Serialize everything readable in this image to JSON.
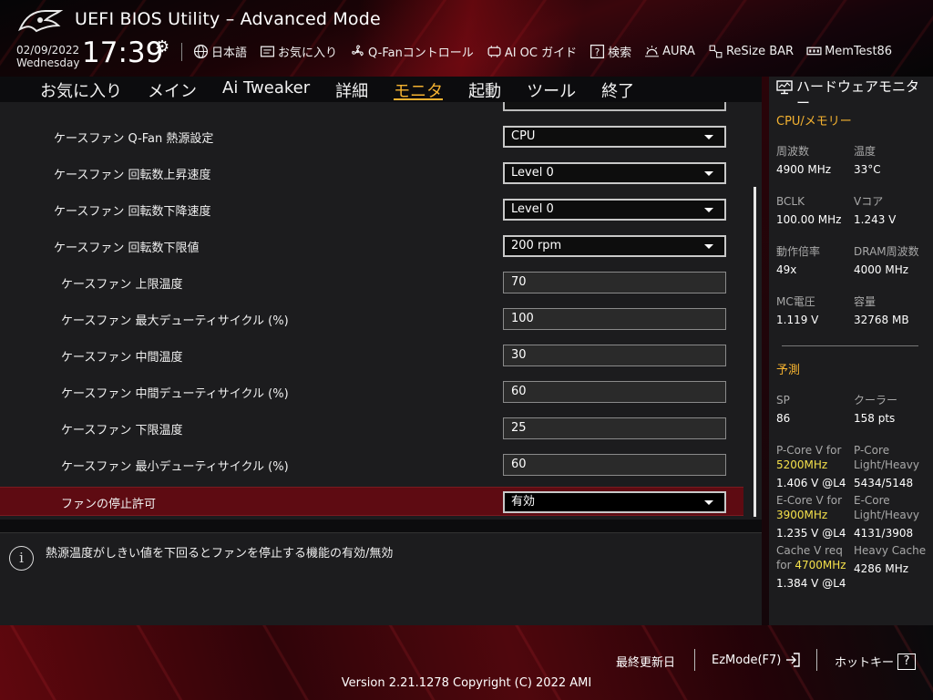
{
  "header": {
    "title": "UEFI BIOS Utility – Advanced Mode",
    "date": "02/09/2022",
    "weekday": "Wednesday",
    "time": "17:39"
  },
  "toolbar": [
    {
      "name": "language",
      "label": "日本語",
      "icon": "globe-icon"
    },
    {
      "name": "favorites",
      "label": "お気に入り",
      "icon": "favorites-icon"
    },
    {
      "name": "qfan",
      "label": "Q-Fanコントロール",
      "icon": "fan-icon"
    },
    {
      "name": "ai-oc",
      "label": "AI OC ガイド",
      "icon": "ai-chip-icon"
    },
    {
      "name": "search",
      "label": "検索",
      "icon": "help-search-icon"
    },
    {
      "name": "aura",
      "label": "AURA",
      "icon": "aura-light-icon"
    },
    {
      "name": "resize-bar",
      "label": "ReSize BAR",
      "icon": "resize-bar-icon"
    },
    {
      "name": "memtest",
      "label": "MemTest86",
      "icon": "memory-icon"
    }
  ],
  "tabs": [
    {
      "label": "お気に入り",
      "active": false
    },
    {
      "label": "メイン",
      "active": false
    },
    {
      "label": "Ai Tweaker",
      "active": false
    },
    {
      "label": "詳細",
      "active": false
    },
    {
      "label": "モニタ",
      "active": true
    },
    {
      "label": "起動",
      "active": false
    },
    {
      "label": "ツール",
      "active": false
    },
    {
      "label": "終了",
      "active": false
    }
  ],
  "settings": [
    {
      "label": "ケースファン Q-Fan 熱源設定",
      "type": "select",
      "value": "CPU",
      "indent": 0
    },
    {
      "label": "ケースファン 回転数上昇速度",
      "type": "select",
      "value": "Level 0",
      "indent": 0
    },
    {
      "label": "ケースファン 回転数下降速度",
      "type": "select",
      "value": "Level 0",
      "indent": 0
    },
    {
      "label": "ケースファン 回転数下限値",
      "type": "select",
      "value": "200 rpm",
      "indent": 0
    },
    {
      "label": "ケースファン 上限温度",
      "type": "number",
      "value": "70",
      "indent": 1
    },
    {
      "label": "ケースファン 最大デューティサイクル (%)",
      "type": "number",
      "value": "100",
      "indent": 1
    },
    {
      "label": "ケースファン 中間温度",
      "type": "number",
      "value": "30",
      "indent": 1
    },
    {
      "label": "ケースファン 中間デューティサイクル (%)",
      "type": "number",
      "value": "60",
      "indent": 1
    },
    {
      "label": "ケースファン 下限温度",
      "type": "number",
      "value": "25",
      "indent": 1
    },
    {
      "label": "ケースファン 最小デューティサイクル (%)",
      "type": "number",
      "value": "60",
      "indent": 1
    },
    {
      "label": "ファンの停止許可",
      "type": "select",
      "value": "有効",
      "indent": 1,
      "selected": true
    }
  ],
  "help": {
    "text": "熱源温度がしきい値を下回るとファンを停止する機能の有効/無効"
  },
  "hw_monitor": {
    "title": "ハードウェアモニター",
    "cpu_section": "CPU/メモリー",
    "cpu": {
      "freq_label": "周波数",
      "freq_value": "4900 MHz",
      "temp_label": "温度",
      "temp_value": "33°C",
      "bclk_label": "BCLK",
      "bclk_value": "100.00 MHz",
      "vcore_label": "Vコア",
      "vcore_value": "1.243 V",
      "ratio_label": "動作倍率",
      "ratio_value": "49x",
      "dram_label": "DRAM周波数",
      "dram_value": "4000 MHz",
      "mc_label": "MC電圧",
      "mc_value": "1.119 V",
      "cap_label": "容量",
      "cap_value": "32768 MB"
    },
    "prediction_section": "予測",
    "prediction": {
      "sp_label": "SP",
      "sp_value": "86",
      "cooler_label": "クーラー",
      "cooler_value": "158 pts",
      "pcore_label_1": "P-Core V for",
      "pcore_freq": "5200MHz",
      "pcore_value": "1.406 V @L4",
      "pcore_lh_label_1": "P-Core",
      "pcore_lh_label_2": "Light/Heavy",
      "pcore_lh_value": "5434/5148",
      "ecore_label_1": "E-Core V for",
      "ecore_freq": "3900MHz",
      "ecore_value": "1.235 V @L4",
      "ecore_lh_label_1": "E-Core",
      "ecore_lh_label_2": "Light/Heavy",
      "ecore_lh_value": "4131/3908",
      "cache_label_1": "Cache V req",
      "cache_label_2": "for",
      "cache_freq": "4700MHz",
      "cache_value": "1.384 V @L4",
      "heavy_cache_label": "Heavy Cache",
      "heavy_cache_value": "4286 MHz"
    }
  },
  "footer": {
    "last_modified": "最終更新日",
    "ezmode": "EzMode(F7)",
    "hotkeys": "ホットキー",
    "hotkey_symbol": "?",
    "version": "Version 2.21.1278 Copyright (C) 2022 AMI"
  },
  "colors": {
    "accent": "#f4b230",
    "highlight": "#f4e04a",
    "selected_row": "#5e0b12",
    "panel": "#1c1c1e"
  }
}
